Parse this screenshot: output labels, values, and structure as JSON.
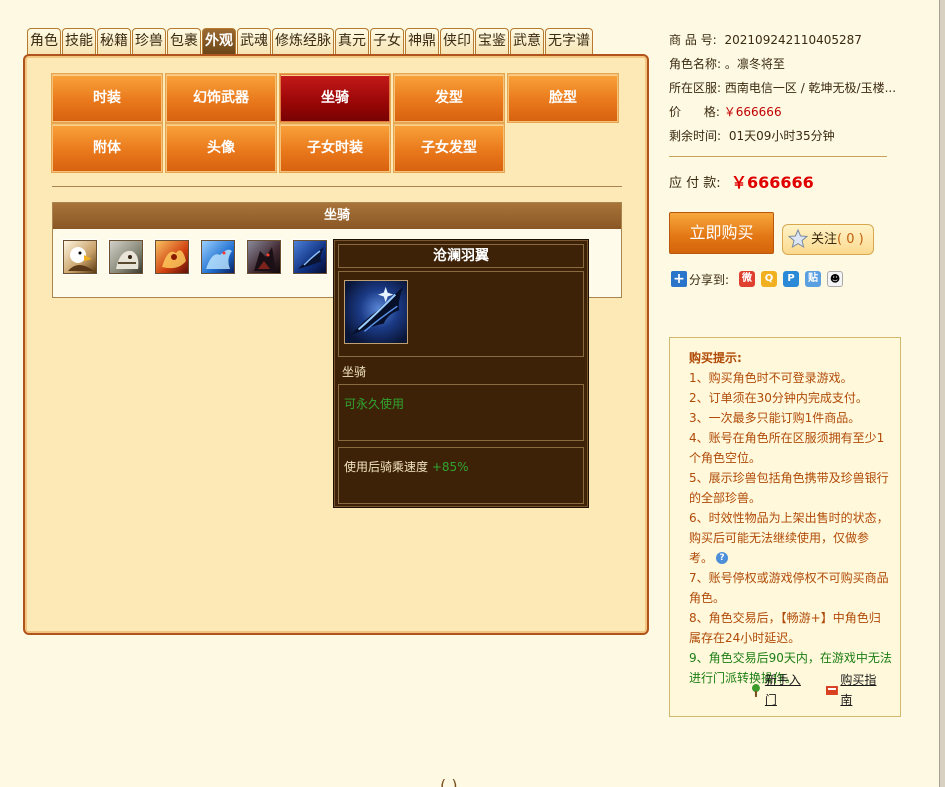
{
  "tabs": [
    "角色",
    "技能",
    "秘籍",
    "珍兽",
    "包裹",
    "外观",
    "武魂",
    "修炼经脉",
    "真元",
    "子女",
    "神鼎",
    "侠印",
    "宝鉴",
    "武意",
    "无字谱"
  ],
  "active_tab": "外观",
  "categories": {
    "row1": [
      "时装",
      "幻饰武器",
      "坐骑",
      "发型",
      "脸型"
    ],
    "row2": [
      "附体",
      "头像",
      "子女时装",
      "子女发型"
    ],
    "active": "坐骑"
  },
  "mount_box": {
    "title": "坐骑"
  },
  "mount_icons": [
    "eagle-mount-icon",
    "white-tiger-mount-icon",
    "fire-beast-mount-icon",
    "blue-dragon-mount-icon",
    "dark-dragon-mount-icon",
    "blue-wing-mount-icon"
  ],
  "tooltip": {
    "name": "沧澜羽翼",
    "type": "坐骑",
    "duration": "可永久使用",
    "effect_label": "使用后骑乘速度",
    "effect_value": "+85%"
  },
  "info": {
    "item_no_label": "商 品 号:",
    "item_no": "20210924211040528​7",
    "role_label": "角色名称:",
    "role": "。凛冬将至",
    "server_label": "所在区服:",
    "server": "西南电信一区 / 乾坤无极/玉楼...",
    "price_label": "价      格:",
    "price": "￥666666",
    "remain_label": "剩余时间:",
    "remain": "01天09小时35分钟",
    "pay_label": "应 付 款:",
    "pay_amount": "￥666666"
  },
  "buttons": {
    "buy": "立即购买",
    "follow": "关注",
    "follow_count": "( 0 )"
  },
  "share": {
    "label": "分享到:"
  },
  "tips": {
    "title": "购买提示:",
    "items": [
      "1、购买角色时不可登录游戏。",
      "2、订单须在30分钟内完成支付。",
      "3、一次最多只能订购1件商品。",
      "4、账号在角色所在区服须拥有至少1个角色空位。",
      "5、展示珍兽包括角色携带及珍兽银行的全部珍兽。",
      "6、时效性物品为上架出售时的状态，购买后可能无法继续使用，仅做参考。",
      "7、账号停权或游戏停权不可购买商品角色。",
      "8、角色交易后，【畅游+】中角色归属存在24小时延迟。",
      "9、角色交易后90天内，在游戏中无法进行门派转换操作。"
    ],
    "link_newbie": "新手入门",
    "link_guide": "购买指南"
  },
  "bottom_partial": "(   )",
  "colors": {
    "accent_orange": "#e8761a",
    "active_red": "#9a0606",
    "price_red": "#e00000",
    "tip_text": "#b04a08",
    "tip_green": "#1c7e14"
  }
}
